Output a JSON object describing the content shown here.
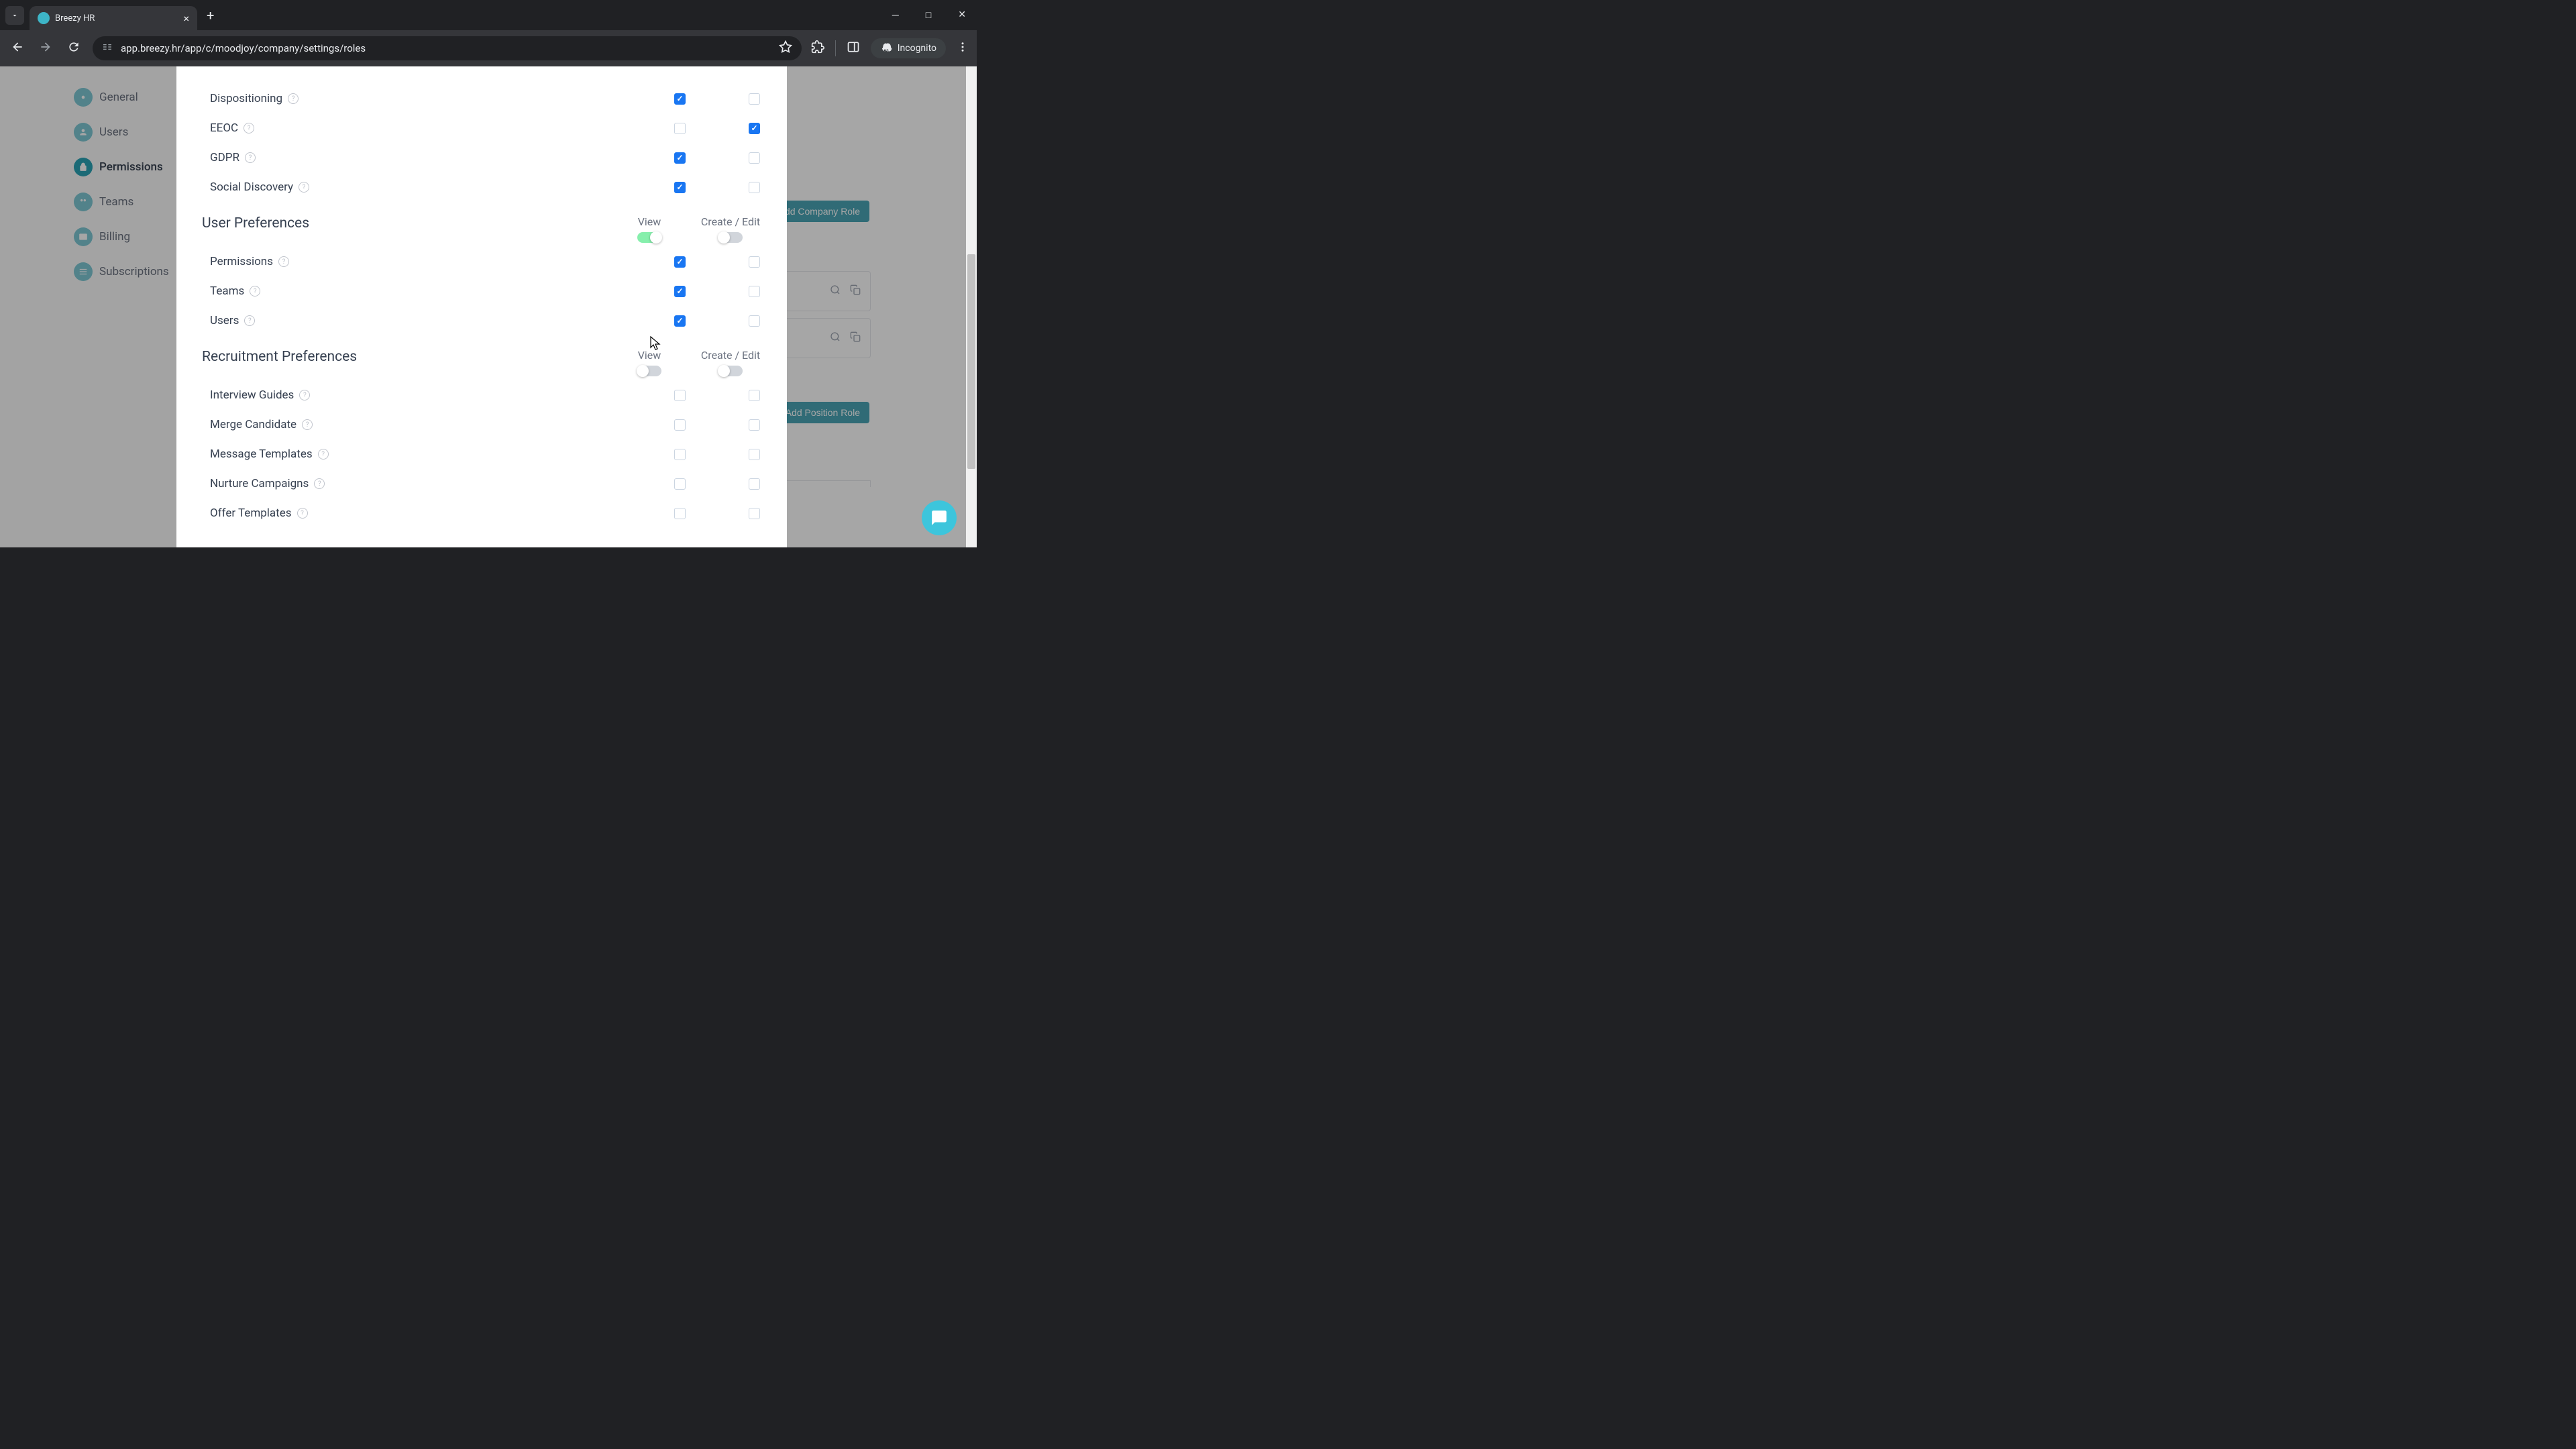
{
  "browser": {
    "tab_title": "Breezy HR",
    "url": "app.breezy.hr/app/c/moodjoy/company/settings/roles",
    "incognito_label": "Incognito"
  },
  "sidebar": {
    "items": [
      {
        "label": "General"
      },
      {
        "label": "Users"
      },
      {
        "label": "Permissions"
      },
      {
        "label": "Teams"
      },
      {
        "label": "Billing"
      },
      {
        "label": "Subscriptions"
      }
    ]
  },
  "bg_buttons": {
    "add_company": "Add Company Role",
    "add_position": "Add Position Role"
  },
  "columns": {
    "view": "View",
    "create_edit": "Create / Edit"
  },
  "sections": [
    {
      "title": "",
      "view_toggle": null,
      "edit_toggle": null,
      "rows": [
        {
          "label": "Dispositioning",
          "view": true,
          "edit": false
        },
        {
          "label": "EEOC",
          "view": false,
          "edit": true
        },
        {
          "label": "GDPR",
          "view": true,
          "edit": false
        },
        {
          "label": "Social Discovery",
          "view": true,
          "edit": false
        }
      ]
    },
    {
      "title": "User Preferences",
      "view_toggle": true,
      "edit_toggle": false,
      "rows": [
        {
          "label": "Permissions",
          "view": true,
          "edit": false
        },
        {
          "label": "Teams",
          "view": true,
          "edit": false
        },
        {
          "label": "Users",
          "view": true,
          "edit": false
        }
      ]
    },
    {
      "title": "Recruitment Preferences",
      "view_toggle": false,
      "edit_toggle": false,
      "rows": [
        {
          "label": "Interview Guides",
          "view": false,
          "edit": false
        },
        {
          "label": "Merge Candidate",
          "view": false,
          "edit": false
        },
        {
          "label": "Message Templates",
          "view": false,
          "edit": false
        },
        {
          "label": "Nurture Campaigns",
          "view": false,
          "edit": false
        },
        {
          "label": "Offer Templates",
          "view": false,
          "edit": false
        }
      ]
    }
  ]
}
